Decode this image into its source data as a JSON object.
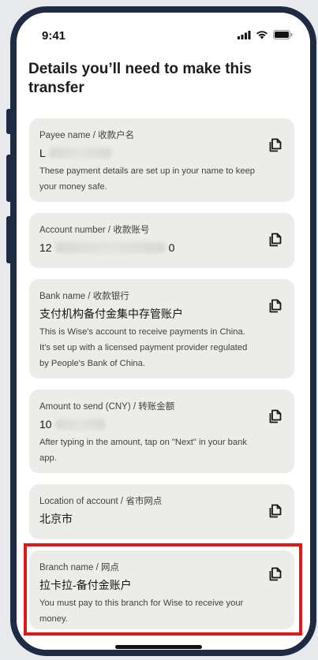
{
  "status": {
    "time": "9:41"
  },
  "page": {
    "title": "Details you’ll need to make this transfer"
  },
  "cards": [
    {
      "label": "Payee name / 收款户名",
      "value": "L",
      "description": "These payment details are set up in your name to keep your money safe."
    },
    {
      "label": "Account number / 收款账号",
      "value_prefix": "12",
      "value_suffix": "0"
    },
    {
      "label": "Bank name / 收款银行",
      "value": "支付机构备付金集中存管账户",
      "description": "This is Wise's account to receive payments in China. It's set up with a licensed payment provider regulated by People's Bank of China."
    },
    {
      "label": "Amount to send (CNY) / 转账金额",
      "value": "10",
      "description": "After typing in the amount, tap on \"Next\" in your bank app."
    },
    {
      "label": "Location of account / 省市网点",
      "value": "北京市"
    },
    {
      "label": "Branch name / 网点",
      "value": "拉卡拉-备付金账户",
      "description": "You must pay to this branch for Wise to receive your money."
    }
  ],
  "icons": {
    "copy": "copy-icon",
    "signal": "signal-icon",
    "wifi": "wifi-icon",
    "battery": "battery-icon"
  },
  "colors": {
    "frame": "#1f2a44",
    "card_bg": "#ecece8",
    "highlight": "#e01818"
  }
}
